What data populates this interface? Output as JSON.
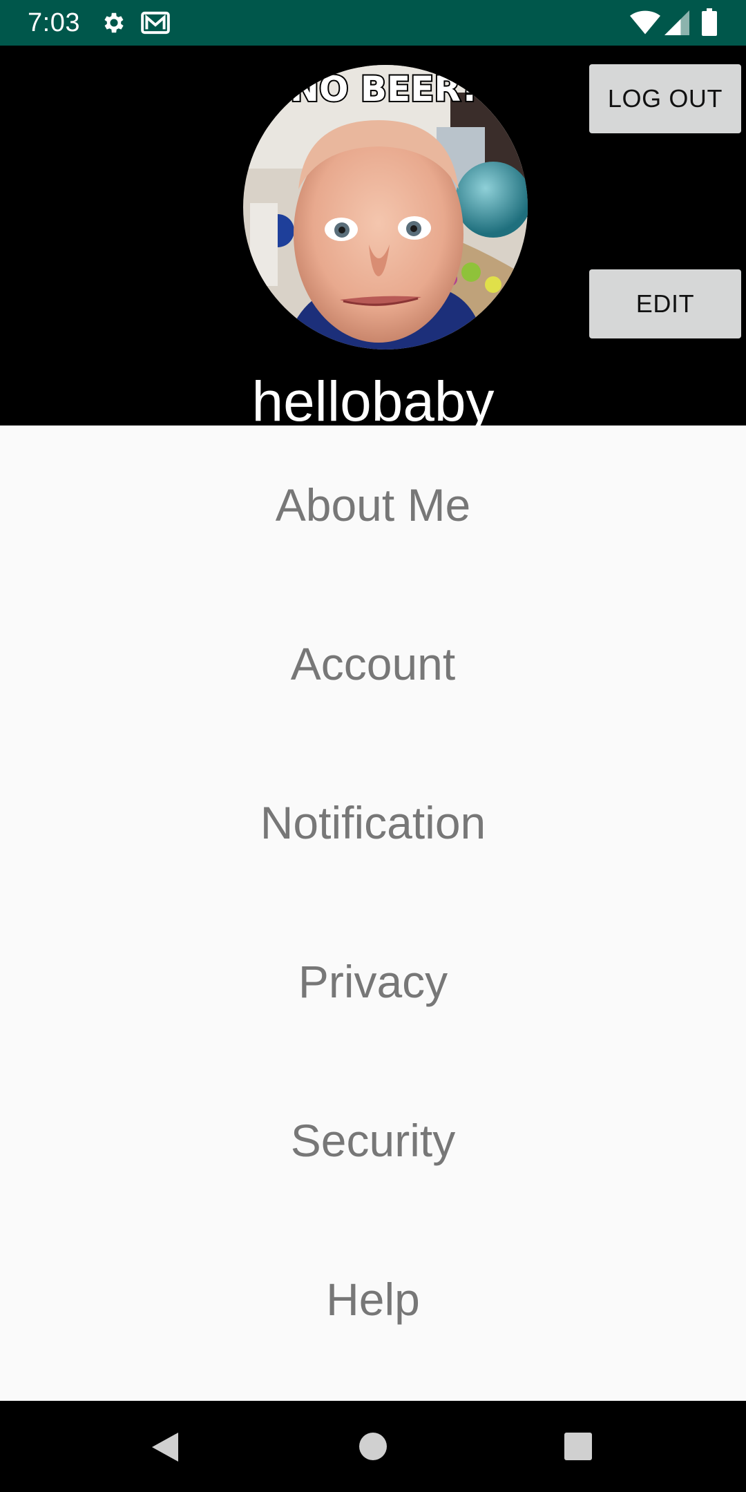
{
  "status_bar": {
    "time": "7:03",
    "icons": [
      "gear-icon",
      "gmail-icon",
      "wifi-icon",
      "cell-signal-icon",
      "battery-icon"
    ],
    "background": "#00574b"
  },
  "profile": {
    "avatar_caption": "NO BEER?",
    "username": "hellobaby",
    "logout_label": "LOG OUT",
    "edit_label": "EDIT"
  },
  "menu": {
    "items": [
      {
        "label": "About Me"
      },
      {
        "label": "Account"
      },
      {
        "label": "Notification"
      },
      {
        "label": "Privacy"
      },
      {
        "label": "Security"
      },
      {
        "label": "Help"
      }
    ]
  },
  "nav_bar": {
    "icons": [
      "back-icon",
      "home-icon",
      "recents-icon"
    ]
  },
  "colors": {
    "header_bg": "#000000",
    "button_bg": "#d6d7d7",
    "menu_text": "#777777",
    "page_bg": "#fafafa"
  }
}
